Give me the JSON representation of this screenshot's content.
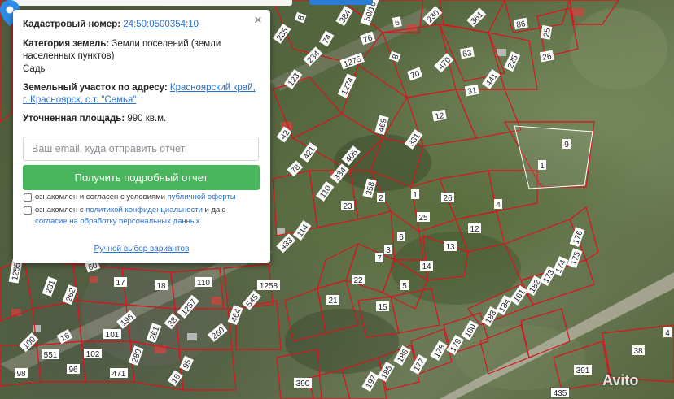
{
  "popup": {
    "cadastral_label": "Кадастровый номер:",
    "cadastral_value": "24:50:0500354:10",
    "category_label": "Категория земель:",
    "category_value": "Земли поселений (земли населенных пунктов)",
    "category_sub": "Сады",
    "address_label": "Земельный участок по адресу:",
    "address_value": "Красноярский край, г. Красноярск, с.т. \"Семья\"",
    "area_label": "Уточненная площадь:",
    "area_value": "990 кв.м.",
    "email_placeholder": "Ваш email, куда отправить отчет",
    "submit_label": "Получить подробный отчет",
    "consent1_text": "ознакомлен и согласен с условиями ",
    "consent1_link": "публичной оферты",
    "consent2_text": "ознакомлен с ",
    "consent2_link1": "политикой конфиденциальности",
    "consent2_mid": " и даю",
    "consent2_link2": "согласие на обработку персональных данных",
    "manual_link": "Ручной выбор вариантов",
    "close_symbol": "×"
  },
  "map": {
    "pin_icon": "map-pin-icon",
    "pin_color": "#2b8ce6",
    "boundary_color": "#d8141c",
    "parcel_labels": [
      "8",
      "384",
      "50/10",
      "230",
      "361",
      "86",
      "25",
      "26",
      "235",
      "74",
      "76",
      "6",
      "83",
      "70",
      "225",
      "234",
      "1275",
      "470",
      "441",
      "123",
      "1274",
      "8",
      "31",
      "12",
      "469",
      "42",
      "331",
      "9",
      "1",
      "421",
      "405",
      "78",
      "334",
      "358",
      "1",
      "110",
      "2",
      "26",
      "23",
      "4",
      "25",
      "12",
      "6",
      "114",
      "433",
      "13",
      "3",
      "14",
      "7",
      "22",
      "5",
      "21",
      "15",
      "176",
      "175",
      "174",
      "173",
      "182",
      "181",
      "184",
      "183",
      "180",
      "179",
      "178",
      "177",
      "186",
      "185",
      "197",
      "60",
      "17",
      "18",
      "110",
      "1258",
      "1255",
      "231",
      "262",
      "196",
      "38",
      "1257",
      "464",
      "261",
      "260",
      "545",
      "100",
      "16",
      "101",
      "551",
      "102",
      "280",
      "95",
      "98",
      "96",
      "471",
      "18",
      "390",
      "391",
      "435",
      "38",
      "4"
    ],
    "watermark": "Avito"
  },
  "colors": {
    "accent_green": "#49b55c",
    "link_blue": "#2a6fc9"
  }
}
